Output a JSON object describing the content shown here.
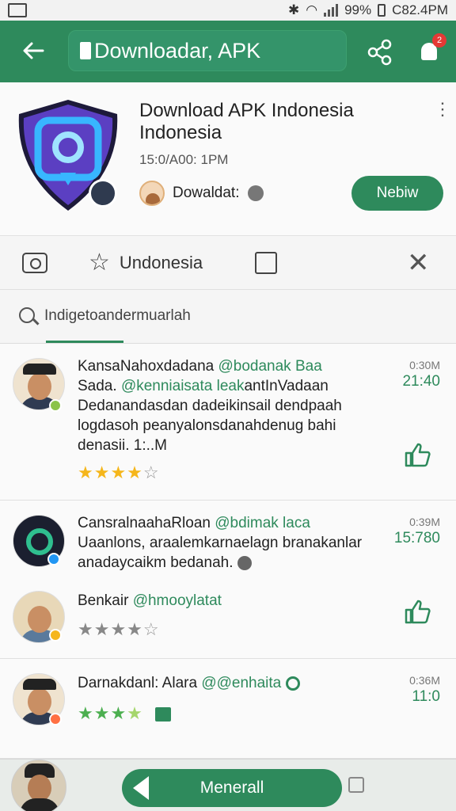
{
  "status_bar": {
    "battery": "99%",
    "time": "C82.4PM"
  },
  "app_bar": {
    "title": "Downloadar, APK",
    "notification_badge": "2"
  },
  "app": {
    "title_line1": "Download APK Indonesia",
    "title_line2": "Indonesia",
    "meta": "15:0/A00:   1PM",
    "developer": "Dowaldat:",
    "install_label": "Nebiw"
  },
  "toolbar": {
    "tab_label": "Undonesia"
  },
  "search": {
    "placeholder": "Indigetoandermuarlah"
  },
  "reviews": [
    {
      "name": "KansaNahoxdadana",
      "handle": "@bodanak Baa",
      "line2_a": "Sada.",
      "line2_b": "@kenniaisata leak",
      "line2_c": "antInVadaan",
      "line3": "Dedanandasdan dadeikinsail dendpaah",
      "line4": "logdasoh peanyalonsdanahdenug bahi",
      "line5": "denasii.  1:..M",
      "time_small": "0:30M",
      "time_big": "21:40",
      "rating": 4,
      "star_color": "#f5b61b"
    },
    {
      "name": "CansralnaahaRloan",
      "handle": "@bdimak laca",
      "line2": "Uaanlons, araalemkarnaelagn branakanlar",
      "line3": "anadaycaikm bedanah.",
      "time_small": "0:39M",
      "time_big": "15:780",
      "rating": 4,
      "star_color": "#888888",
      "sub_name": "Benkair",
      "sub_handle": "@hmooylatat"
    },
    {
      "name": "Darnakdanl: Alara",
      "handle": "@@enhaita",
      "time_small": "0:36M",
      "time_big": "11:0",
      "rating": 3.5,
      "star_color": "#4caf50"
    }
  ],
  "bottom_bar": {
    "button_label": "Menerall"
  },
  "colors": {
    "primary": "#2e8a5c",
    "star_gold": "#f5b61b",
    "badge_red": "#e53935"
  }
}
